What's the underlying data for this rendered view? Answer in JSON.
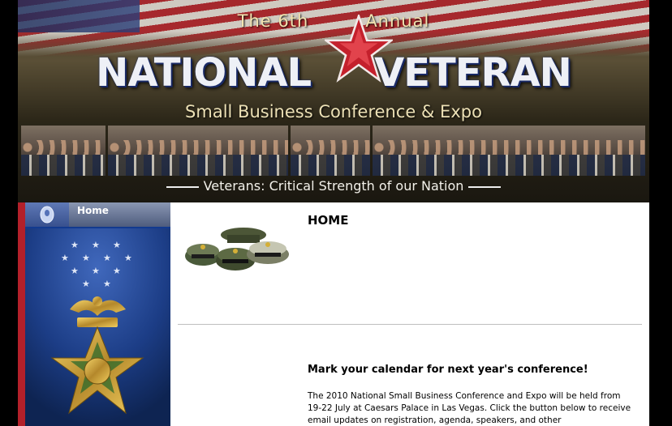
{
  "banner": {
    "annual_left": "The 6th",
    "annual_right": "Annual",
    "title_word1": "NATIONAL",
    "title_word2": "VETERAN",
    "subtitle": "Small Business Conference & Expo",
    "tagline": "Veterans: Critical Strength of our Nation",
    "colors": {
      "star_red": "#c4202c",
      "title_blue": "#1a2a66",
      "gold_text": "#ece0b5"
    }
  },
  "sidebar": {
    "nav_items": [
      {
        "label": "Home",
        "icon": "home-bullet-icon"
      }
    ],
    "image": "medal-of-honor-image",
    "colors": {
      "background": "#123a8f",
      "stripe": "#b3202a"
    }
  },
  "content": {
    "heading": "HOME",
    "image": "military-caps-image",
    "announcement_heading": "Mark your calendar for next year's conference!",
    "announcement_body": "The 2010 National Small Business Conference and Expo will be held from 19-22 July at Caesars Palace in Las Vegas. Click the button below to receive email updates on registration, agenda, speakers, and other announcements.*"
  }
}
